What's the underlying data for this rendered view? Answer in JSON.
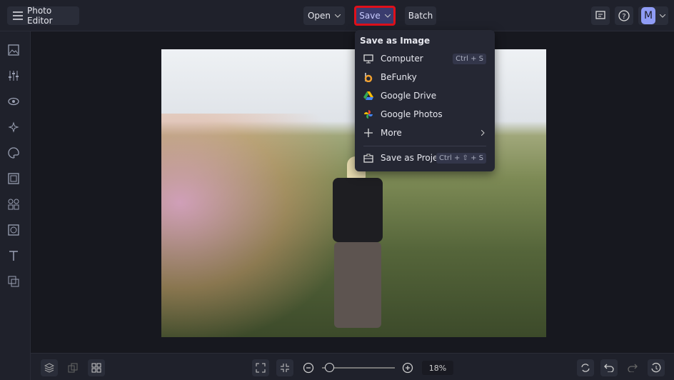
{
  "header": {
    "title": "Photo Editor",
    "open_label": "Open",
    "save_label": "Save",
    "batch_label": "Batch",
    "avatar_initial": "M"
  },
  "save_menu": {
    "heading": "Save as Image",
    "items": [
      {
        "label": "Computer",
        "shortcut": "Ctrl + S",
        "icon": "monitor-icon"
      },
      {
        "label": "BeFunky",
        "icon": "befunky-icon"
      },
      {
        "label": "Google Drive",
        "icon": "google-drive-icon"
      },
      {
        "label": "Google Photos",
        "icon": "google-photos-icon"
      },
      {
        "label": "More",
        "icon": "plus-icon"
      },
      {
        "label": "Save as Project",
        "shortcut": "Ctrl + ⇧ + S",
        "icon": "briefcase-icon"
      }
    ]
  },
  "zoom": {
    "level": "18%",
    "fraction": 0.05
  },
  "colors": {
    "highlight": "#e0101a",
    "save_bg": "#3a3c6e",
    "avatar": "#8f9cf5"
  }
}
